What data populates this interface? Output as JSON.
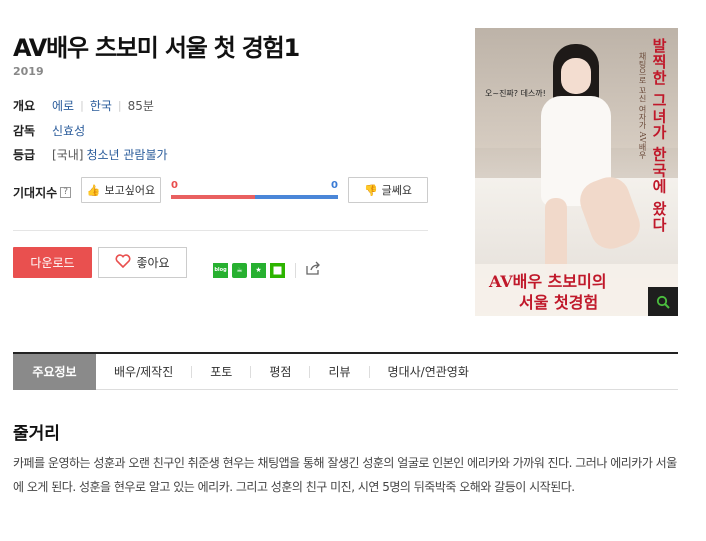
{
  "movie": {
    "title": "AV배우 츠보미 서울 첫 경험1",
    "year": "2019"
  },
  "info": {
    "overview_label": "개요",
    "genre": "에로",
    "country": "한국",
    "runtime": "85분",
    "director_label": "감독",
    "director": "신효성",
    "rating_label": "등급",
    "rating_region": "[국내]",
    "rating": "청소년 관람불가"
  },
  "expectation": {
    "label": "기대지수",
    "help": "?",
    "want_label": "보고싶어요",
    "hate_label": "글쎄요",
    "want_count": "0",
    "hate_count": "0",
    "want_fraction": 0.5,
    "hate_fraction": 0.5,
    "want_color": "#e96060",
    "hate_color": "#4a86d8"
  },
  "actions": {
    "download_label": "다운로드",
    "like_label": "좋아요",
    "share_icons": [
      "naver-blog-icon",
      "naver-cafe-icon",
      "bookmark-star-icon",
      "memo-icon",
      "share-icon"
    ],
    "blog_text": "blog"
  },
  "poster": {
    "vertical_title": "발찍한 그녀가 한국에 왔다",
    "vertical_sub": "채팅으로 꼬신 여자가 AV배우",
    "bubble": "오~진짜? 데스까!",
    "bottom_title_1": "AV배우 츠보미의",
    "bottom_title_2": "서울 첫경험",
    "search_icon": "magnifier-icon"
  },
  "tabs": [
    "주요정보",
    "배우/제작진",
    "포토",
    "평점",
    "리뷰",
    "명대사/연관영화"
  ],
  "synopsis": {
    "heading": "줄거리",
    "text": "카페를 운영하는 성훈과 오랜 친구인 취준생 현우는 채팅앱을 통해 잘생긴 성훈의 얼굴로 인본인 에리카와 가까워 진다. 그러나 에리카가 서울에 오게 된다. 성훈을 현우로 알고 있는 에리카. 그리고 성훈의 친구 미진, 시연 5명의 뒤죽박죽 오해와 갈등이 시작된다."
  },
  "colors": {
    "accent_red": "#e9504f",
    "link_blue": "#2b5c9b",
    "poster_red": "#c0182a",
    "share_green": "#27b030"
  }
}
